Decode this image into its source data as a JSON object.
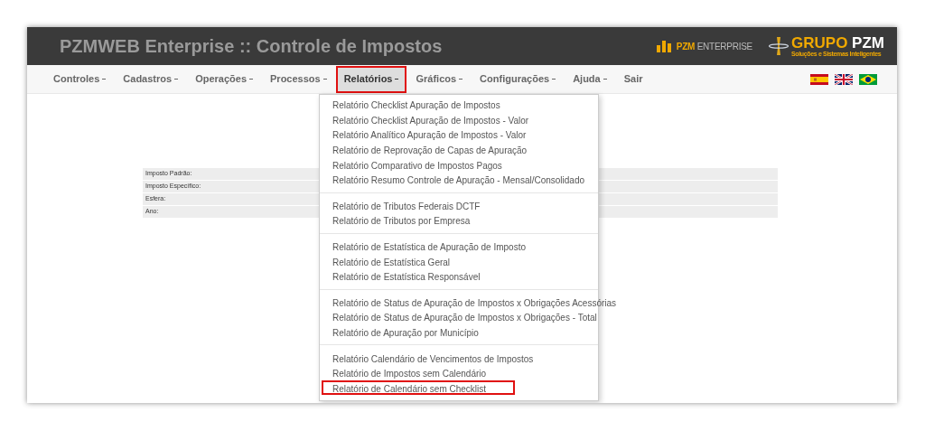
{
  "header": {
    "title": "PZMWEB Enterprise :: Controle de Impostos",
    "product_logo": {
      "bold": "PZM",
      "light": "ENTERPRISE"
    },
    "group_logo": {
      "name_a": "GRUPO",
      "name_b": "PZM",
      "tagline": "Soluções e Sistemas Inteligentes"
    }
  },
  "nav": [
    {
      "label": "Controles",
      "caret": true,
      "selected": false,
      "highlighted": false
    },
    {
      "label": "Cadastros",
      "caret": true,
      "selected": false,
      "highlighted": false
    },
    {
      "label": "Operações",
      "caret": true,
      "selected": false,
      "highlighted": false
    },
    {
      "label": "Processos",
      "caret": true,
      "selected": false,
      "highlighted": false
    },
    {
      "label": "Relatórios",
      "caret": true,
      "selected": true,
      "highlighted": true
    },
    {
      "label": "Gráficos",
      "caret": true,
      "selected": false,
      "highlighted": false
    },
    {
      "label": "Configurações",
      "caret": true,
      "selected": false,
      "highlighted": false
    },
    {
      "label": "Ajuda",
      "caret": true,
      "selected": false,
      "highlighted": false
    },
    {
      "label": "Sair",
      "caret": false,
      "selected": false,
      "highlighted": false
    }
  ],
  "languages": [
    {
      "kind": "spain"
    },
    {
      "kind": "uk"
    },
    {
      "kind": "brazil"
    }
  ],
  "filters": [
    "Imposto Padrão:",
    "Imposto Específico:",
    "Esfera:",
    "Ano:"
  ],
  "menu_groups": [
    [
      {
        "label": "Relatório Checklist Apuração de Impostos",
        "highlighted": false
      },
      {
        "label": "Relatório Checklist Apuração de Impostos - Valor",
        "highlighted": false
      },
      {
        "label": "Relatório Analítico Apuração de Impostos - Valor",
        "highlighted": false
      },
      {
        "label": "Relatório de Reprovação de Capas de Apuração",
        "highlighted": false
      },
      {
        "label": "Relatório Comparativo de Impostos Pagos",
        "highlighted": false
      },
      {
        "label": "Relatório Resumo Controle de Apuração - Mensal/Consolidado",
        "highlighted": false
      }
    ],
    [
      {
        "label": "Relatório de Tributos Federais DCTF",
        "highlighted": false
      },
      {
        "label": "Relatório de Tributos por Empresa",
        "highlighted": false
      }
    ],
    [
      {
        "label": "Relatório de Estatística de Apuração de Imposto",
        "highlighted": false
      },
      {
        "label": "Relatório de Estatística Geral",
        "highlighted": false
      },
      {
        "label": "Relatório de Estatística Responsável",
        "highlighted": false
      }
    ],
    [
      {
        "label": "Relatório de Status de Apuração de Impostos x Obrigações Acessórias",
        "highlighted": false
      },
      {
        "label": "Relatório de Status de Apuração de Impostos x Obrigações - Total",
        "highlighted": false
      },
      {
        "label": "Relatório de Apuração por Município",
        "highlighted": false
      }
    ],
    [
      {
        "label": "Relatório Calendário de Vencimentos de Impostos",
        "highlighted": false
      },
      {
        "label": "Relatório de Impostos sem Calendário",
        "highlighted": false
      },
      {
        "label": "Relatório de Calendário sem Checklist",
        "highlighted": true
      }
    ]
  ]
}
